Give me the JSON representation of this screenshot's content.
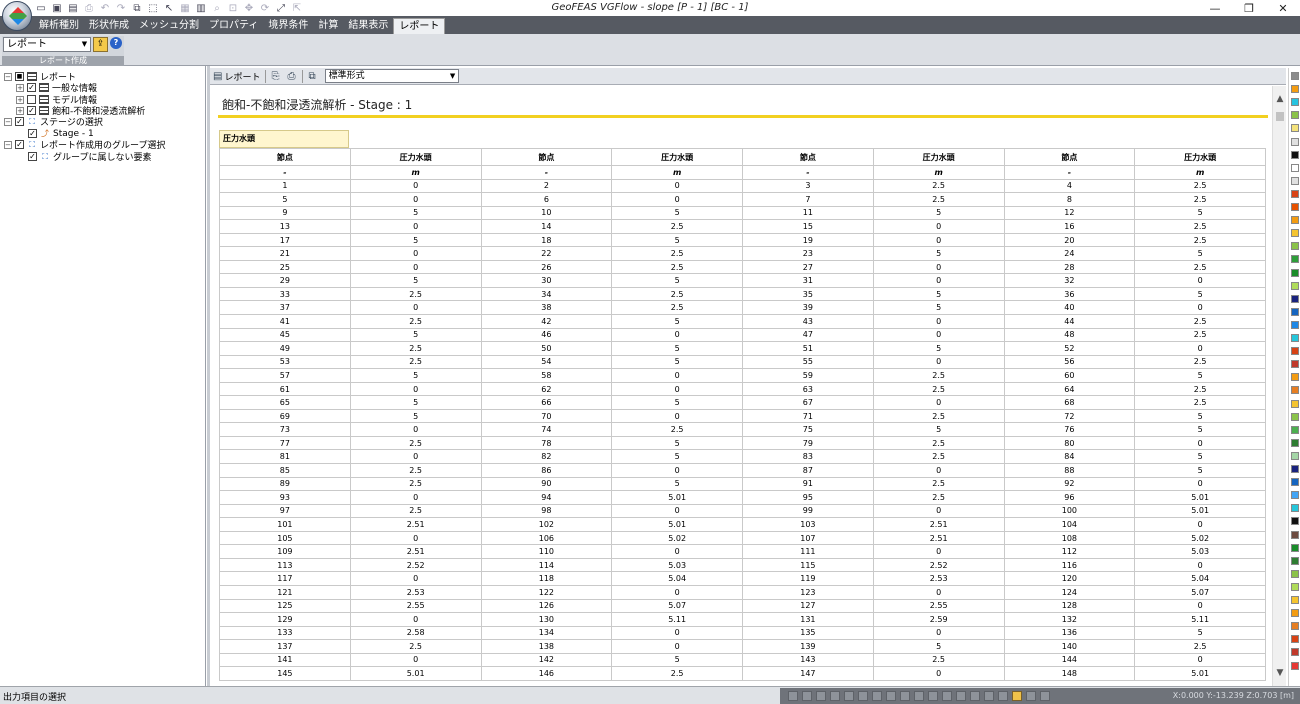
{
  "window": {
    "title": "GeoFEAS VGFlow - slope [P - 1] [BC - 1]",
    "controls": {
      "minimize": "—",
      "restore": "❐",
      "close": "✕"
    }
  },
  "ribbon": {
    "tabs": [
      {
        "label": "解析種別"
      },
      {
        "label": "形状作成"
      },
      {
        "label": "メッシュ分割"
      },
      {
        "label": "プロパティ"
      },
      {
        "label": "境界条件"
      },
      {
        "label": "計算"
      },
      {
        "label": "結果表示"
      },
      {
        "label": "レポート"
      }
    ],
    "active_tab": "レポート",
    "report_select_value": "レポート",
    "group_label": "レポート作成"
  },
  "tree": {
    "items": [
      {
        "label": "レポート"
      },
      {
        "label": "一般な情報"
      },
      {
        "label": "モデル情報"
      },
      {
        "label": "飽和-不飽和浸透流解析"
      },
      {
        "label": "ステージの選択"
      },
      {
        "label": "Stage - 1"
      },
      {
        "label": "レポート作成用のグループ選択"
      },
      {
        "label": "グループに属しない要素"
      }
    ]
  },
  "report_toolbar": {
    "report_label": "レポート",
    "format_value": "標準形式"
  },
  "report": {
    "title": "飽和-不飽和浸透流解析 - Stage : 1",
    "section": "圧力水頭",
    "header_node": "節点",
    "header_value": "圧力水頭",
    "unit_node": "-",
    "unit_value": "m",
    "rows": [
      [
        "1",
        "0",
        "2",
        "0",
        "3",
        "2.5",
        "4",
        "2.5"
      ],
      [
        "5",
        "0",
        "6",
        "0",
        "7",
        "2.5",
        "8",
        "2.5"
      ],
      [
        "9",
        "5",
        "10",
        "5",
        "11",
        "5",
        "12",
        "5"
      ],
      [
        "13",
        "0",
        "14",
        "2.5",
        "15",
        "0",
        "16",
        "2.5"
      ],
      [
        "17",
        "5",
        "18",
        "5",
        "19",
        "0",
        "20",
        "2.5"
      ],
      [
        "21",
        "0",
        "22",
        "2.5",
        "23",
        "5",
        "24",
        "5"
      ],
      [
        "25",
        "0",
        "26",
        "2.5",
        "27",
        "0",
        "28",
        "2.5"
      ],
      [
        "29",
        "5",
        "30",
        "5",
        "31",
        "0",
        "32",
        "0"
      ],
      [
        "33",
        "2.5",
        "34",
        "2.5",
        "35",
        "5",
        "36",
        "5"
      ],
      [
        "37",
        "0",
        "38",
        "2.5",
        "39",
        "5",
        "40",
        "0"
      ],
      [
        "41",
        "2.5",
        "42",
        "5",
        "43",
        "0",
        "44",
        "2.5"
      ],
      [
        "45",
        "5",
        "46",
        "0",
        "47",
        "0",
        "48",
        "2.5"
      ],
      [
        "49",
        "2.5",
        "50",
        "5",
        "51",
        "5",
        "52",
        "0"
      ],
      [
        "53",
        "2.5",
        "54",
        "5",
        "55",
        "0",
        "56",
        "2.5"
      ],
      [
        "57",
        "5",
        "58",
        "0",
        "59",
        "2.5",
        "60",
        "5"
      ],
      [
        "61",
        "0",
        "62",
        "0",
        "63",
        "2.5",
        "64",
        "2.5"
      ],
      [
        "65",
        "5",
        "66",
        "5",
        "67",
        "0",
        "68",
        "2.5"
      ],
      [
        "69",
        "5",
        "70",
        "0",
        "71",
        "2.5",
        "72",
        "5"
      ],
      [
        "73",
        "0",
        "74",
        "2.5",
        "75",
        "5",
        "76",
        "5"
      ],
      [
        "77",
        "2.5",
        "78",
        "5",
        "79",
        "2.5",
        "80",
        "0"
      ],
      [
        "81",
        "0",
        "82",
        "5",
        "83",
        "2.5",
        "84",
        "5"
      ],
      [
        "85",
        "2.5",
        "86",
        "0",
        "87",
        "0",
        "88",
        "5"
      ],
      [
        "89",
        "2.5",
        "90",
        "5",
        "91",
        "2.5",
        "92",
        "0"
      ],
      [
        "93",
        "0",
        "94",
        "5.01",
        "95",
        "2.5",
        "96",
        "5.01"
      ],
      [
        "97",
        "2.5",
        "98",
        "0",
        "99",
        "0",
        "100",
        "5.01"
      ],
      [
        "101",
        "2.51",
        "102",
        "5.01",
        "103",
        "2.51",
        "104",
        "0"
      ],
      [
        "105",
        "0",
        "106",
        "5.02",
        "107",
        "2.51",
        "108",
        "5.02"
      ],
      [
        "109",
        "2.51",
        "110",
        "0",
        "111",
        "0",
        "112",
        "5.03"
      ],
      [
        "113",
        "2.52",
        "114",
        "5.03",
        "115",
        "2.52",
        "116",
        "0"
      ],
      [
        "117",
        "0",
        "118",
        "5.04",
        "119",
        "2.53",
        "120",
        "5.04"
      ],
      [
        "121",
        "2.53",
        "122",
        "0",
        "123",
        "0",
        "124",
        "5.07"
      ],
      [
        "125",
        "2.55",
        "126",
        "5.07",
        "127",
        "2.55",
        "128",
        "0"
      ],
      [
        "129",
        "0",
        "130",
        "5.11",
        "131",
        "2.59",
        "132",
        "5.11"
      ],
      [
        "133",
        "2.58",
        "134",
        "0",
        "135",
        "0",
        "136",
        "5"
      ],
      [
        "137",
        "2.5",
        "138",
        "0",
        "139",
        "5",
        "140",
        "2.5"
      ],
      [
        "141",
        "0",
        "142",
        "5",
        "143",
        "2.5",
        "144",
        "0"
      ],
      [
        "145",
        "5.01",
        "146",
        "2.5",
        "147",
        "0",
        "148",
        "5.01"
      ]
    ]
  },
  "palette": {
    "colors": [
      "#8c8c8c",
      "#f39c12",
      "#27c4e0",
      "#8bc34a",
      "#f4e27a",
      "#e0e0e0",
      "#111111",
      "#ffffff",
      "#e0e0e0",
      "#d84315",
      "#e65100",
      "#f39c12",
      "#f4c430",
      "#8bc34a",
      "#2e9e3a",
      "#1a8d2a",
      "#b0dc5a",
      "#1a237e",
      "#1565c0",
      "#1e88e5",
      "#26c6da",
      "#d84315",
      "#c0392b",
      "#f39c12",
      "#e67e22",
      "#f4c430",
      "#8bc34a",
      "#4caf50",
      "#2e7d32",
      "#a5d6a7",
      "#1a237e",
      "#1565c0",
      "#42a5f5",
      "#26c6da",
      "#111111",
      "#6d4c41",
      "#1a8d2a",
      "#2e7d32",
      "#8bc34a",
      "#b0dc5a",
      "#f4c430",
      "#f39c12",
      "#e67e22",
      "#d84315",
      "#c0392b",
      "#e53935"
    ]
  },
  "status": {
    "text": "出力項目の選択",
    "coords": "X:0.000 Y:-13.239 Z:0.703 [m]"
  }
}
